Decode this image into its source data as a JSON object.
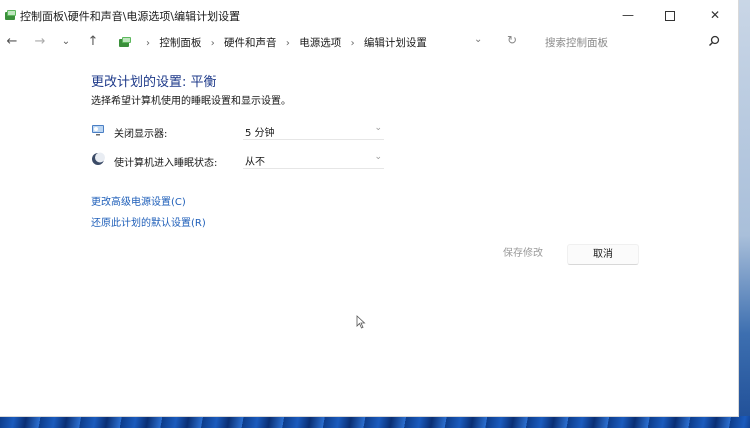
{
  "window": {
    "title": "控制面板\\硬件和声音\\电源选项\\编辑计划设置",
    "controls": {
      "minimize": "—",
      "close": "✕"
    }
  },
  "nav": {
    "back": "←",
    "forward": "→",
    "recent": "⌄",
    "up": "↑",
    "breadcrumbs": [
      "控制面板",
      "硬件和声音",
      "电源选项",
      "编辑计划设置"
    ],
    "separator": "›",
    "address_dropdown": "⌄",
    "refresh": "↻",
    "search_placeholder": "搜索控制面板"
  },
  "main": {
    "title": "更改计划的设置: 平衡",
    "subtitle": "选择希望计算机使用的睡眠设置和显示设置。",
    "settings": [
      {
        "label": "关闭显示器:",
        "value": "5 分钟",
        "icon": "monitor-icon"
      },
      {
        "label": "使计算机进入睡眠状态:",
        "value": "从不",
        "icon": "moon-icon"
      }
    ],
    "links": {
      "advanced": "更改高级电源设置(C)",
      "restore": "还原此计划的默认设置(R)"
    },
    "buttons": {
      "save": "保存修改",
      "cancel": "取消"
    }
  },
  "colors": {
    "title": "#1e3a8a",
    "link": "#1f5fb9",
    "disabled": "#9a9a9a"
  }
}
